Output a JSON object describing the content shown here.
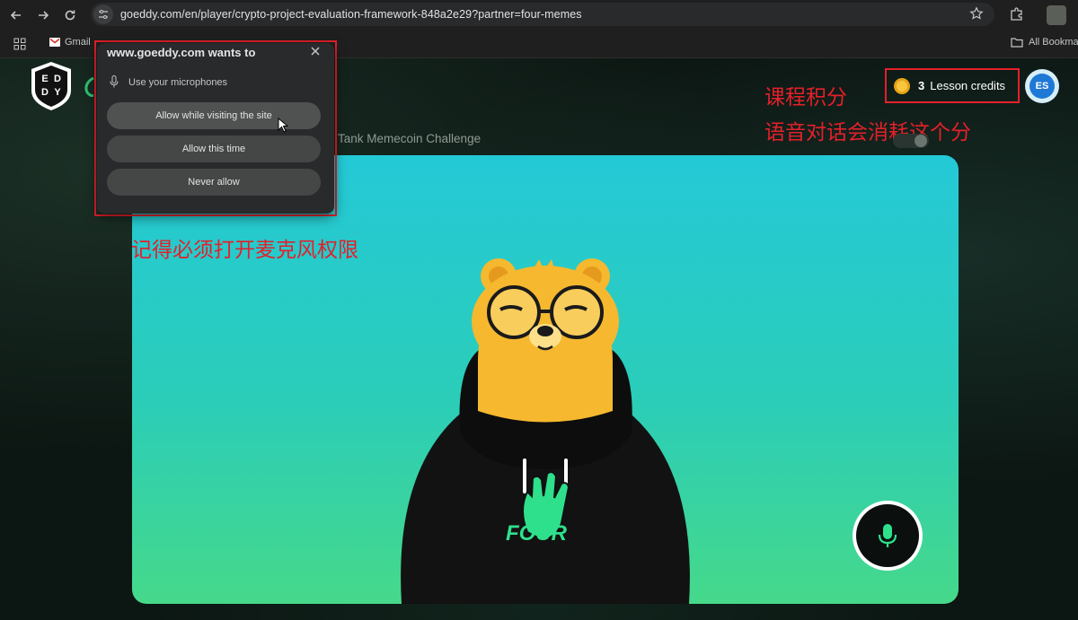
{
  "browser": {
    "url": "goeddy.com/en/player/crypto-project-evaluation-framework-848a2e29?partner=four-memes",
    "bookmarks": [
      {
        "label": "Gmail"
      }
    ],
    "all_bookmarks_label": "All Bookmar"
  },
  "permission_prompt": {
    "title": "www.goeddy.com wants to",
    "request": "Use your microphones",
    "buttons": {
      "allow_site": "Allow while visiting the site",
      "allow_once": "Allow this time",
      "never": "Never allow"
    }
  },
  "header": {
    "logo_letters": [
      "E",
      "D",
      "D",
      "Y"
    ],
    "lesson_title": "Tank Memecoin Challenge",
    "credits": {
      "count": "3",
      "label": "Lesson credits"
    },
    "avatar_initials": "ES"
  },
  "annotations": {
    "credits_title": "课程积分",
    "credits_note": "语音对话会消耗这个分",
    "mic_note": "记得必须打开麦克风权限"
  },
  "stage": {
    "hoodie_text": "FOUR"
  },
  "colors": {
    "annotation_red": "#e3202a",
    "stage_top": "#24c9d7",
    "stage_bottom": "#46d98a",
    "bear_yellow": "#f5b82e",
    "hoodie": "#121212"
  },
  "icons": {
    "back": "back-arrow-icon",
    "forward": "forward-arrow-icon",
    "reload": "reload-icon",
    "site_info": "tune-icon",
    "bookmark": "star-icon",
    "extensions": "puzzle-icon",
    "apps": "apps-grid-icon",
    "folder": "folder-icon",
    "close": "close-icon",
    "microphone": "microphone-icon",
    "coin": "coin-icon"
  }
}
